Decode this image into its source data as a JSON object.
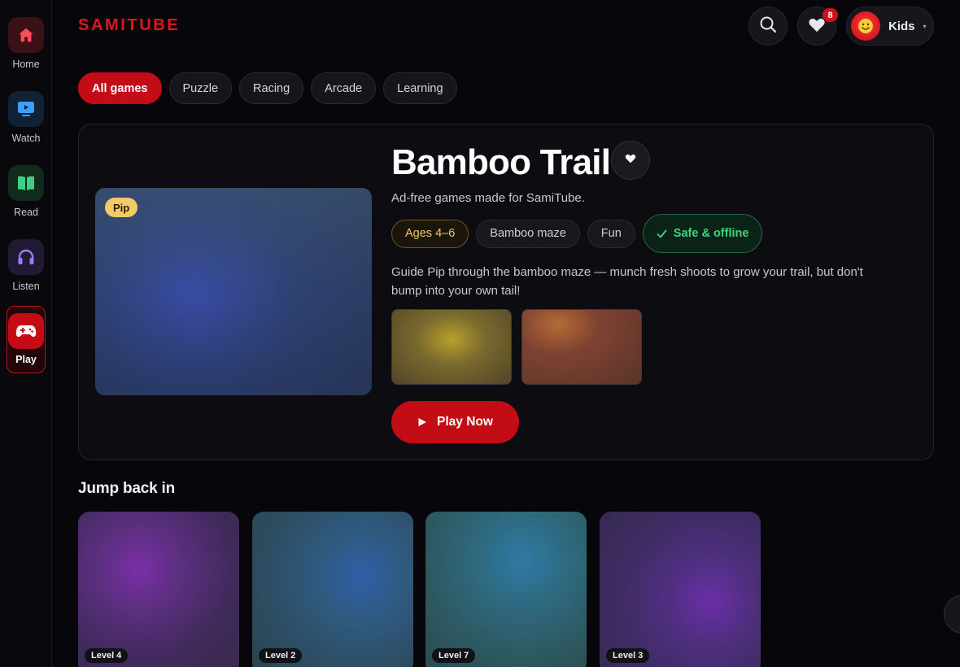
{
  "brand": {
    "logo_text": "SAMITUBE",
    "accent_color": "#c40c17"
  },
  "sidebar": {
    "items": [
      {
        "label": "Home",
        "icon": "home-icon"
      },
      {
        "label": "Watch",
        "icon": "tv-icon"
      },
      {
        "label": "Read",
        "icon": "book-icon"
      },
      {
        "label": "Listen",
        "icon": "headphones-icon"
      },
      {
        "label": "Play",
        "icon": "gamepad-icon",
        "active": true
      }
    ]
  },
  "header": {
    "search_icon": "search-icon",
    "favorites_icon": "heart-icon",
    "favorites_count": "8",
    "profile": {
      "name": "Kids",
      "avatar": "smiley-icon"
    }
  },
  "filters": {
    "items": [
      "All games",
      "Puzzle",
      "Racing",
      "Arcade",
      "Learning"
    ],
    "active": "All games"
  },
  "hero": {
    "character_tag": "Pip",
    "title": "Bamboo Trail",
    "subtitle": "Ad-free games made for SamiTube.",
    "tags": [
      "Ages 4–6",
      "Bamboo maze",
      "Fun",
      "Safe & offline"
    ],
    "description": "Guide Pip through the bamboo maze — munch fresh shoots to grow your trail, but don't bump into your own tail!",
    "play_label": "Play Now"
  },
  "jump_back": {
    "title": "Jump back in",
    "cards": [
      {
        "level": "Level 4"
      },
      {
        "level": "Level 2"
      },
      {
        "level": "Level 7"
      },
      {
        "level": "Level 3"
      }
    ]
  }
}
